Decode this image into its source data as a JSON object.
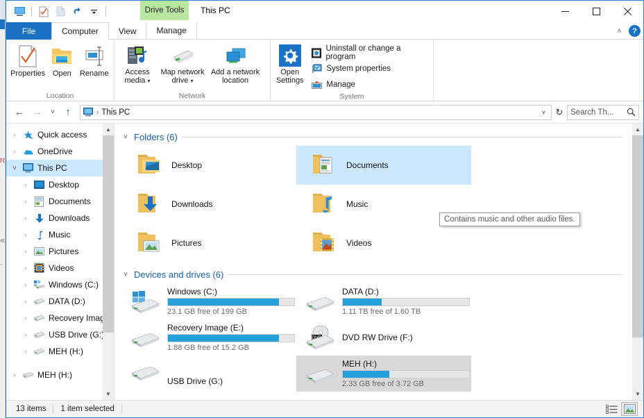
{
  "window": {
    "title": "This PC",
    "contextual_tab_group": "Drive Tools",
    "minimize": "—",
    "maximize": "☐",
    "close": "✕",
    "ribbon_collapse": "∧",
    "help": "?"
  },
  "quick_access_toolbar": {
    "items": [
      {
        "name": "this-pc-icon",
        "label": ""
      },
      {
        "name": "properties-icon",
        "label": ""
      },
      {
        "name": "new-folder-icon",
        "label": ""
      },
      {
        "name": "undo-icon",
        "label": ""
      },
      {
        "name": "customize-dropdown-icon",
        "label": ""
      }
    ]
  },
  "tabs": [
    {
      "label": "File",
      "id": "file",
      "state": "file"
    },
    {
      "label": "Computer",
      "id": "computer",
      "state": "active"
    },
    {
      "label": "View",
      "id": "view",
      "state": "normal"
    },
    {
      "label": "Manage",
      "id": "manage",
      "state": "contextual"
    }
  ],
  "ribbon": {
    "groups": [
      {
        "label": "Location",
        "buttons": [
          {
            "label": "Properties",
            "icon": "properties-icon",
            "dropdown": false
          },
          {
            "label": "Open",
            "icon": "open-folder-icon",
            "dropdown": false
          },
          {
            "label": "Rename",
            "icon": "rename-icon",
            "dropdown": false
          }
        ]
      },
      {
        "label": "Network",
        "buttons": [
          {
            "label": "Access media",
            "icon": "access-media-icon",
            "dropdown": true
          },
          {
            "label": "Map network drive",
            "icon": "map-network-drive-icon",
            "dropdown": true
          },
          {
            "label": "Add a network location",
            "icon": "add-network-location-icon",
            "dropdown": false
          }
        ]
      },
      {
        "label": "System",
        "big_button": {
          "label": "Open Settings",
          "icon": "gear-icon"
        },
        "small_buttons": [
          {
            "label": "Uninstall or change a program",
            "icon": "uninstall-program-icon"
          },
          {
            "label": "System properties",
            "icon": "system-properties-icon"
          },
          {
            "label": "Manage",
            "icon": "manage-icon"
          }
        ]
      }
    ]
  },
  "addressbar": {
    "back": "←",
    "forward": "→",
    "recent": "˅",
    "up": "↑",
    "path_icon": "this-pc-icon",
    "path_separator": "›",
    "path_text": "This PC",
    "dropdown": "˅",
    "refresh": "↻",
    "search_placeholder": "Search Th...",
    "search_value": "",
    "search_icon": "search-icon"
  },
  "navpane": {
    "items": [
      {
        "label": "Quick access",
        "icon": "star-pin-icon",
        "indent": 0,
        "expander": "›",
        "selected": false
      },
      {
        "label": "OneDrive",
        "icon": "onedrive-cloud-icon",
        "indent": 0,
        "expander": "›",
        "selected": false
      },
      {
        "label": "This PC",
        "icon": "this-pc-icon",
        "indent": 0,
        "expander": "˅",
        "selected": true
      },
      {
        "label": "Desktop",
        "icon": "desktop-icon",
        "indent": 1,
        "expander": "›",
        "selected": false
      },
      {
        "label": "Documents",
        "icon": "documents-icon",
        "indent": 1,
        "expander": "›",
        "selected": false
      },
      {
        "label": "Downloads",
        "icon": "downloads-icon",
        "indent": 1,
        "expander": "›",
        "selected": false
      },
      {
        "label": "Music",
        "icon": "music-icon",
        "indent": 1,
        "expander": "›",
        "selected": false
      },
      {
        "label": "Pictures",
        "icon": "pictures-icon",
        "indent": 1,
        "expander": "›",
        "selected": false
      },
      {
        "label": "Videos",
        "icon": "videos-icon",
        "indent": 1,
        "expander": "›",
        "selected": false
      },
      {
        "label": "Windows (C:)",
        "icon": "windows-drive-icon",
        "indent": 1,
        "expander": "›",
        "selected": false
      },
      {
        "label": "DATA (D:)",
        "icon": "drive-icon",
        "indent": 1,
        "expander": "›",
        "selected": false
      },
      {
        "label": "Recovery Image (E:)",
        "icon": "drive-icon",
        "indent": 1,
        "expander": "›",
        "selected": false
      },
      {
        "label": "USB Drive (G:)",
        "icon": "drive-icon",
        "indent": 1,
        "expander": "›",
        "selected": false
      },
      {
        "label": "MEH (H:)",
        "icon": "drive-icon",
        "indent": 1,
        "expander": "›",
        "selected": false
      },
      {
        "label": "MEH (H:)",
        "icon": "drive-icon",
        "indent": 0,
        "expander": "›",
        "selected": false
      }
    ]
  },
  "content": {
    "folders_group": {
      "title": "Folders (6)",
      "chevron": "˅",
      "items": [
        {
          "label": "Desktop",
          "icon": "folder-desktop-icon",
          "selected": false
        },
        {
          "label": "Documents",
          "icon": "folder-documents-icon",
          "selected": true
        },
        {
          "label": "Downloads",
          "icon": "folder-downloads-icon",
          "selected": false
        },
        {
          "label": "Music",
          "icon": "folder-music-icon",
          "selected": false
        },
        {
          "label": "Pictures",
          "icon": "folder-pictures-icon",
          "selected": false
        },
        {
          "label": "Videos",
          "icon": "folder-videos-icon",
          "selected": false
        }
      ]
    },
    "drives_group": {
      "title": "Devices and drives (6)",
      "chevron": "˅",
      "items": [
        {
          "label": "Windows (C:)",
          "icon": "windows-drive-icon",
          "free": "23.1 GB free of 199 GB",
          "used_percent": 88,
          "bar": true,
          "highlight": false
        },
        {
          "label": "DATA (D:)",
          "icon": "drive-icon",
          "free": "1.11 TB free of 1.60 TB",
          "used_percent": 31,
          "bar": true,
          "highlight": false
        },
        {
          "label": "Recovery Image (E:)",
          "icon": "drive-icon",
          "free": "1.88 GB free of 15.2 GB",
          "used_percent": 88,
          "bar": true,
          "highlight": false
        },
        {
          "label": "DVD RW Drive (F:)",
          "icon": "dvd-drive-icon",
          "free": "",
          "used_percent": 0,
          "bar": false,
          "highlight": false
        },
        {
          "label": "USB Drive (G:)",
          "icon": "drive-icon",
          "free": "",
          "used_percent": 0,
          "bar": false,
          "highlight": false
        },
        {
          "label": "MEH (H:)",
          "icon": "drive-icon",
          "free": "2.33 GB free of 3.72 GB",
          "used_percent": 37,
          "bar": true,
          "highlight": true
        }
      ]
    },
    "tooltip": {
      "text": "Contains music and other audio files."
    }
  },
  "statusbar": {
    "item_count": "13 items",
    "selection": "1 item selected",
    "details_view_icon": "details-view-icon",
    "large_icons_view_icon": "large-icons-view-icon"
  },
  "colors": {
    "accent": "#1b72c4",
    "selection": "#cce8ff",
    "gray_selection": "#d9d9d9",
    "drive_bar_blue": "#26a0da",
    "contextual_tab": "#b9e6a0",
    "group_title": "#1b5fa8"
  }
}
